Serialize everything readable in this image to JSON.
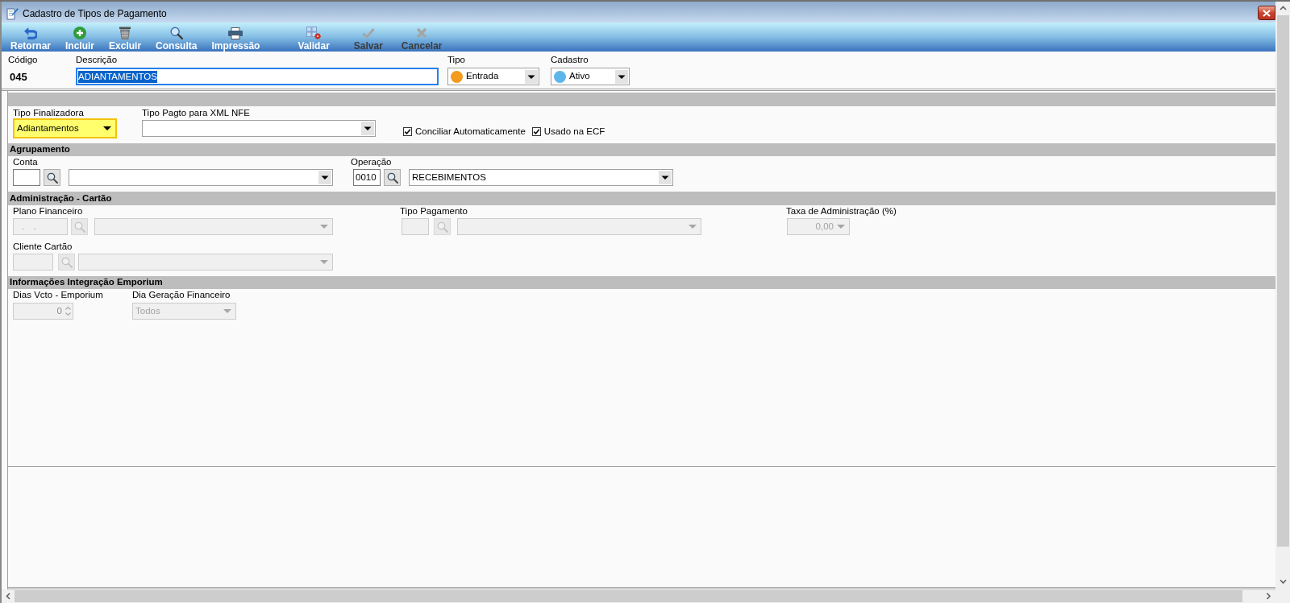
{
  "window": {
    "title": "Cadastro de Tipos de Pagamento"
  },
  "toolbar": [
    {
      "label": "Retornar",
      "kind": "back",
      "disabled": false
    },
    {
      "label": "Incluir",
      "kind": "add",
      "disabled": false
    },
    {
      "label": "Excluir",
      "kind": "delete",
      "disabled": false
    },
    {
      "label": "Consulta",
      "kind": "search",
      "disabled": false
    },
    {
      "label": "Impressão",
      "kind": "print",
      "disabled": false
    },
    {
      "label": "Validar",
      "kind": "validate",
      "disabled": false
    },
    {
      "label": "Salvar",
      "kind": "save",
      "disabled": true
    },
    {
      "label": "Cancelar",
      "kind": "cancel",
      "disabled": true
    }
  ],
  "header": {
    "code": {
      "label": "Código",
      "value": "045"
    },
    "description": {
      "label": "Descrição",
      "value": "ADIANTAMENTOS",
      "focused": true,
      "text_selected": true
    },
    "selects": [
      {
        "label": "Tipo",
        "value": "Entrada",
        "color": "#f29b1d"
      },
      {
        "label": "Cadastro",
        "value": "Ativo",
        "color": "#5cb6ea"
      }
    ]
  },
  "general": {
    "tipo_finalizadora": {
      "label": "Tipo Finalizadora",
      "value": "Adiantamentos",
      "highlighted": true
    },
    "tipo_pagto_xml": {
      "label": "Tipo Pagto para XML NFE"
    },
    "checkboxes": [
      {
        "label": "Conciliar Automaticamente",
        "checked": true
      },
      {
        "label": "Usado na ECF",
        "checked": true
      }
    ]
  },
  "agrupamento": {
    "title": "Agrupamento",
    "conta": {
      "label": "Conta",
      "disabled": false
    },
    "operacao": {
      "label": "Operação",
      "code": "0010",
      "value": "RECEBIMENTOS",
      "disabled": false
    }
  },
  "administracao_cartao": {
    "title": "Administração - Cartão",
    "plano_financeiro": {
      "label": "Plano Financeiro",
      "code": ". .",
      "disabled": true
    },
    "tipo_pagamento": {
      "label": "Tipo Pagamento",
      "disabled": true
    },
    "taxa_administracao": {
      "label": "Taxa de Administração (%)",
      "value": "0,00",
      "disabled": true
    },
    "cliente_cartao": {
      "label": "Cliente Cartão",
      "disabled": true
    }
  },
  "integracao_emporium": {
    "title": "Informações Integração Emporium",
    "dias_vcto": {
      "label": "Dias Vcto - Emporium",
      "value": "0",
      "disabled": true
    },
    "dia_geracao_financeiro": {
      "label": "Dia Geração Financeiro",
      "value": "Todos",
      "disabled": true
    }
  }
}
